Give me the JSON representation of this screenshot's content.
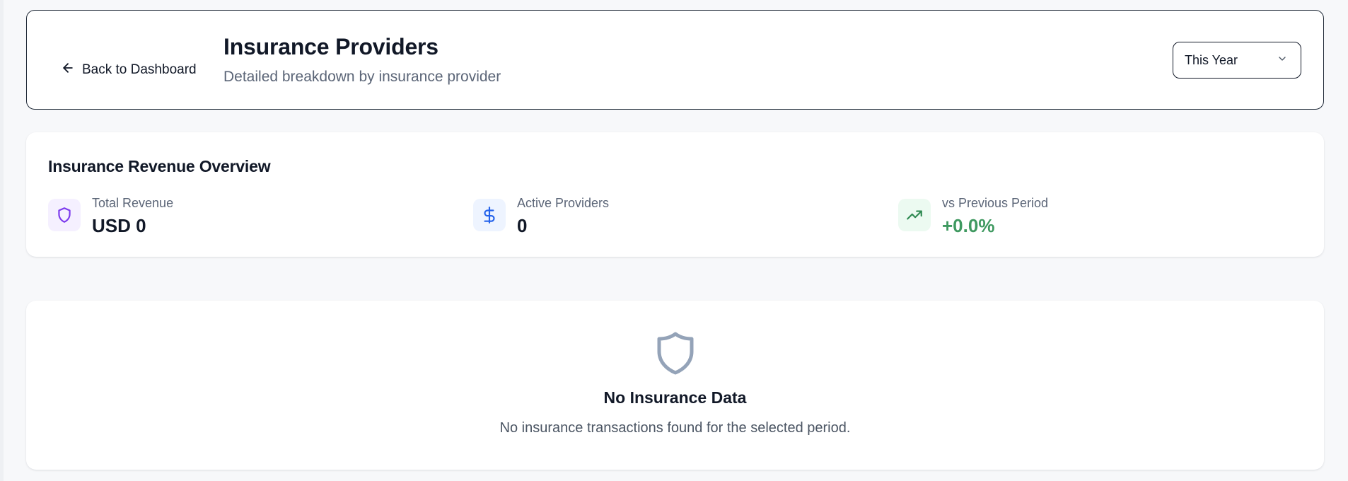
{
  "header": {
    "back_label": "Back to Dashboard",
    "title": "Insurance Providers",
    "subtitle": "Detailed breakdown by insurance provider",
    "period_selected": "This Year"
  },
  "overview": {
    "title": "Insurance Revenue Overview",
    "stats": [
      {
        "label": "Total Revenue",
        "value": "USD 0",
        "icon": "shield-icon",
        "color": "#7c3aed"
      },
      {
        "label": "Active Providers",
        "value": "0",
        "icon": "dollar-icon",
        "color": "#2563eb"
      },
      {
        "label": "vs Previous Period",
        "value": "+0.0%",
        "icon": "trending-up-icon",
        "color": "#3f9960"
      }
    ]
  },
  "empty_state": {
    "icon": "shield-icon",
    "title": "No Insurance Data",
    "message": "No insurance transactions found for the selected period."
  }
}
